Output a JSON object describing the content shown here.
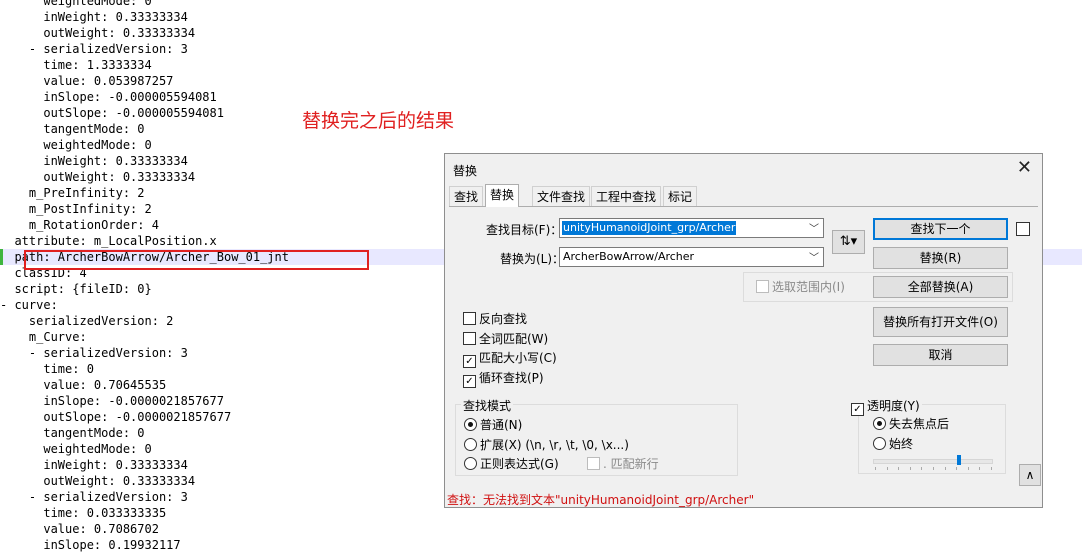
{
  "editor": {
    "lines": [
      "      weightedMode: 0",
      "      inWeight: 0.33333334",
      "      outWeight: 0.33333334",
      "    - serializedVersion: 3",
      "      time: 1.3333334",
      "      value: 0.053987257",
      "      inSlope: -0.000005594081",
      "      outSlope: -0.000005594081",
      "      tangentMode: 0",
      "      weightedMode: 0",
      "      inWeight: 0.33333334",
      "      outWeight: 0.33333334",
      "    m_PreInfinity: 2",
      "    m_PostInfinity: 2",
      "    m_RotationOrder: 4",
      "  attribute: m_LocalPosition.x",
      "  path: ArcherBowArrow/Archer_Bow_01_jnt",
      "  classID: 4",
      "  script: {fileID: 0}",
      "- curve:",
      "    serializedVersion: 2",
      "    m_Curve:",
      "    - serializedVersion: 3",
      "      time: 0",
      "      value: 0.70645535",
      "      inSlope: -0.0000021857677",
      "      outSlope: -0.0000021857677",
      "      tangentMode: 0",
      "      weightedMode: 0",
      "      inWeight: 0.33333334",
      "      outWeight: 0.33333334",
      "    - serializedVersion: 3",
      "      time: 0.033333335",
      "      value: 0.7086702",
      "      inSlope: 0.19932117"
    ],
    "annotation": "替换完之后的结果",
    "highlight_color": "#e02020"
  },
  "dialog": {
    "title": "替换",
    "close": "✕",
    "tabs": [
      "查找",
      "替换",
      "文件查找",
      "工程中查找",
      "标记"
    ],
    "find_label": "查找目标(F)：",
    "find_value": "unityHumanoidJoint_grp/Archer",
    "replace_label": "替换为(L)：",
    "replace_value": "ArcherBowArrow/Archer",
    "swap_icon": "⇅▾",
    "in_selection": "选取范围内(I)",
    "buttons": {
      "find_next": "查找下一个",
      "replace": "替换(R)",
      "replace_all": "全部替换(A)",
      "replace_all_open": "替换所有打开文件(O)",
      "cancel": "取消"
    },
    "options": {
      "backward": "反向查找",
      "whole_word": "全词匹配(W)",
      "match_case": "匹配大小写(C)",
      "wrap": "循环查找(P)"
    },
    "search_mode": {
      "title": "查找模式",
      "normal": "普通(N)",
      "extended": "扩展(X) (\\n, \\r, \\t, \\0, \\x...)",
      "regex": "正则表达式(G)",
      "dot_newline": ". 匹配新行"
    },
    "transparency": {
      "title": "透明度(Y)",
      "on_lose_focus": "失去焦点后",
      "always": "始终",
      "level": 0.72
    },
    "collapse_icon": "∧",
    "status": "查找：无法找到文本\"unityHumanoidJoint_grp/Archer\""
  }
}
